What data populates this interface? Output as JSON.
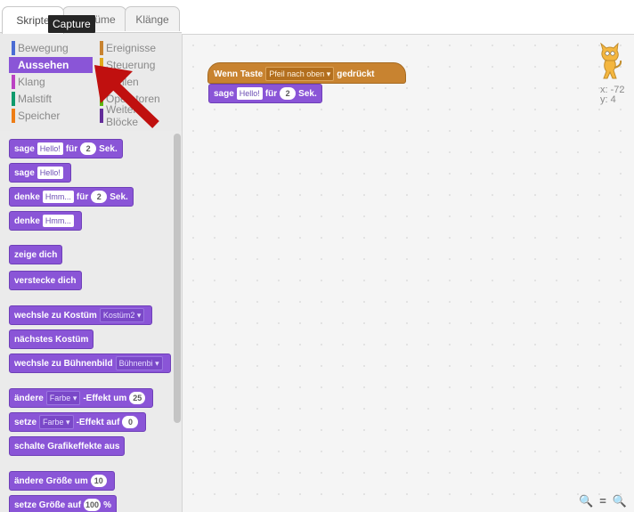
{
  "tabs": {
    "scripts": "Skripte",
    "costumes": "Kostüme",
    "sounds": "Klänge",
    "tooltip": "Capture"
  },
  "categories": [
    {
      "label": "Bewegung",
      "color": "#4a6cd4"
    },
    {
      "label": "Aussehen",
      "color": "#8a55d7"
    },
    {
      "label": "Klang",
      "color": "#bb42c3"
    },
    {
      "label": "Malstift",
      "color": "#0e9a6c"
    },
    {
      "label": "Speicher",
      "color": "#ee7d16"
    },
    {
      "label": "Ereignisse",
      "color": "#c88330"
    },
    {
      "label": "Steuerung",
      "color": "#e1a91a"
    },
    {
      "label": "Fühlen",
      "color": "#2ca5e2"
    },
    {
      "label": "Operatoren",
      "color": "#5cb712"
    },
    {
      "label": "Weitere Blöcke",
      "color": "#632d99"
    }
  ],
  "blocks": {
    "say_for": {
      "a": "sage",
      "msg": "Hello!",
      "b": "für",
      "secs": "2",
      "c": "Sek."
    },
    "say": {
      "a": "sage",
      "msg": "Hello!"
    },
    "think_for": {
      "a": "denke",
      "msg": "Hmm...",
      "b": "für",
      "secs": "2",
      "c": "Sek."
    },
    "think": {
      "a": "denke",
      "msg": "Hmm..."
    },
    "show": "zeige dich",
    "hide": "verstecke dich",
    "switch_costume": {
      "a": "wechsle zu Kostüm",
      "val": "Kostüm2"
    },
    "next_costume": "nächstes Kostüm",
    "switch_backdrop": {
      "a": "wechsle zu Bühnenbild",
      "val": "Bühnenbi"
    },
    "change_effect": {
      "a": "ändere",
      "effect": "Farbe",
      "b": "-Effekt um",
      "val": "25"
    },
    "set_effect": {
      "a": "setze",
      "effect": "Farbe",
      "b": "-Effekt auf",
      "val": "0"
    },
    "clear_effects": "schalte Grafikeffekte aus",
    "change_size": {
      "a": "ändere Größe um",
      "val": "10"
    },
    "set_size": {
      "a": "setze Größe auf",
      "val": "100",
      "unit": "%"
    }
  },
  "script": {
    "hat": {
      "a": "Wenn Taste",
      "key": "Pfeil nach oben",
      "b": "gedrückt"
    },
    "say_for": {
      "a": "sage",
      "msg": "Hello!",
      "b": "für",
      "secs": "2",
      "c": "Sek."
    }
  },
  "sprite": {
    "x": "x: -72",
    "y": "y: 4"
  },
  "zoom": {
    "out": "🔍",
    "reset": "=",
    "in": "🔍"
  }
}
